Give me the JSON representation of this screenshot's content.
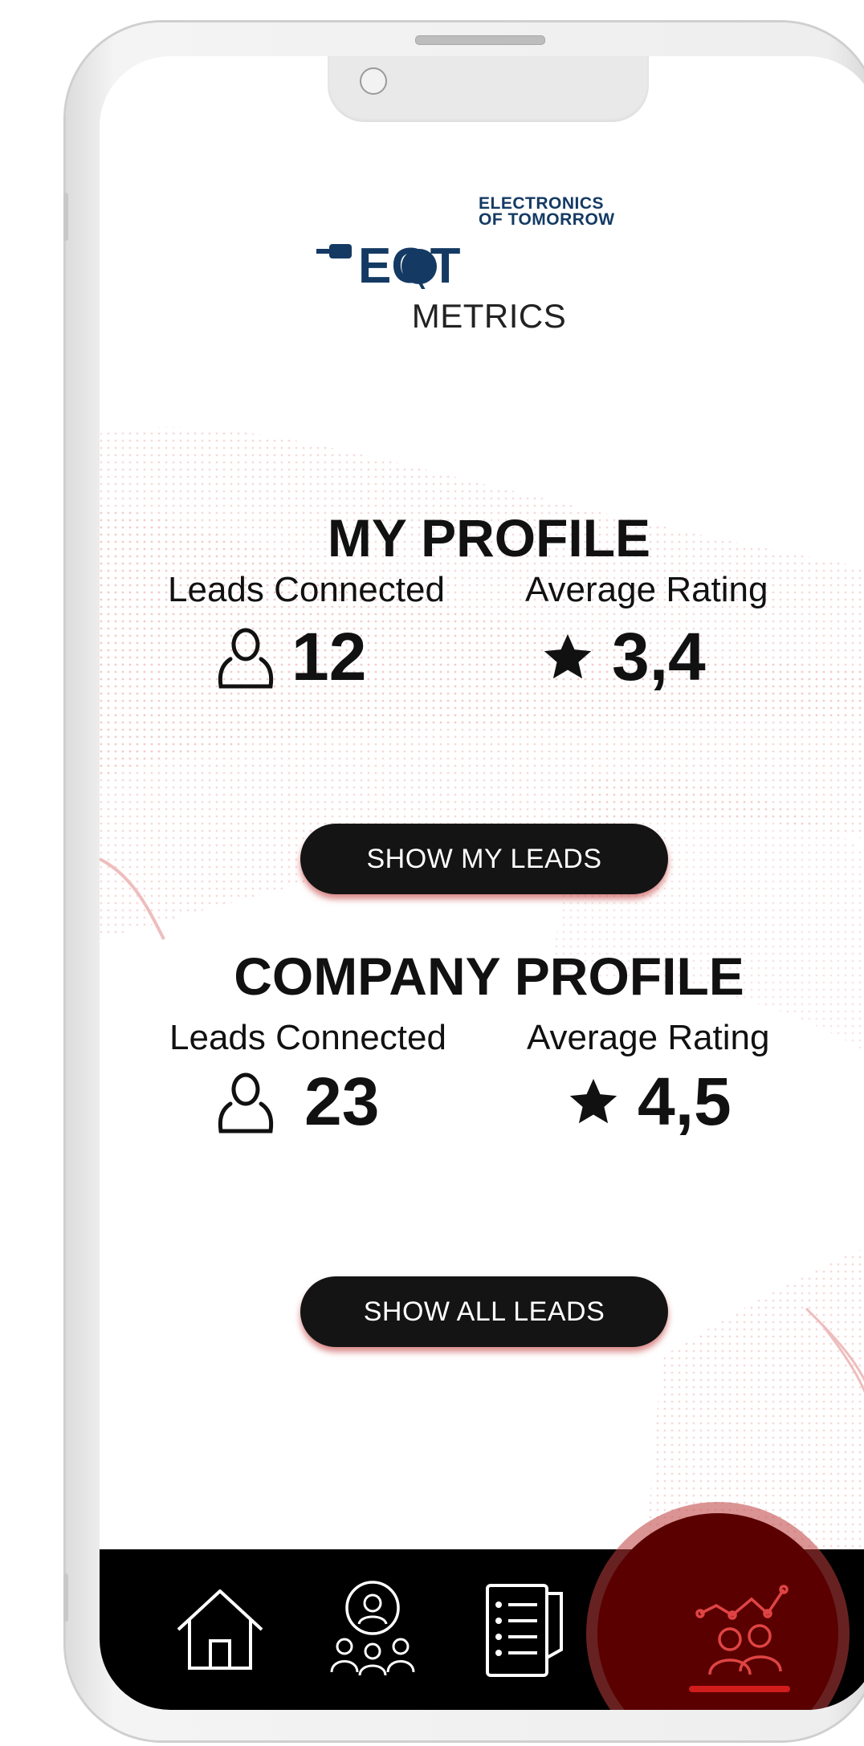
{
  "brand": {
    "logo_letters": "EOT",
    "name_line1": "ELECTRONICS",
    "name_line2": "OF TOMORROW"
  },
  "page": {
    "title": "METRICS"
  },
  "my_profile": {
    "heading": "MY PROFILE",
    "leads_label": "Leads Connected",
    "leads_value": "12",
    "rating_label": "Average Rating",
    "rating_value": "3,4",
    "button_label": "SHOW MY LEADS"
  },
  "company_profile": {
    "heading": "COMPANY PROFILE",
    "leads_label": "Leads Connected",
    "leads_value": "23",
    "rating_label": "Average Rating",
    "rating_value": "4,5",
    "button_label": "SHOW ALL LEADS"
  },
  "nav": {
    "items": [
      {
        "icon": "home-icon"
      },
      {
        "icon": "lead-search-icon"
      },
      {
        "icon": "list-icon"
      },
      {
        "icon": "metrics-icon",
        "active": true
      }
    ]
  },
  "colors": {
    "brand_navy": "#143a63",
    "accent_red": "#d11c1c",
    "nav_bg": "#000000",
    "button_bg": "#141414"
  }
}
